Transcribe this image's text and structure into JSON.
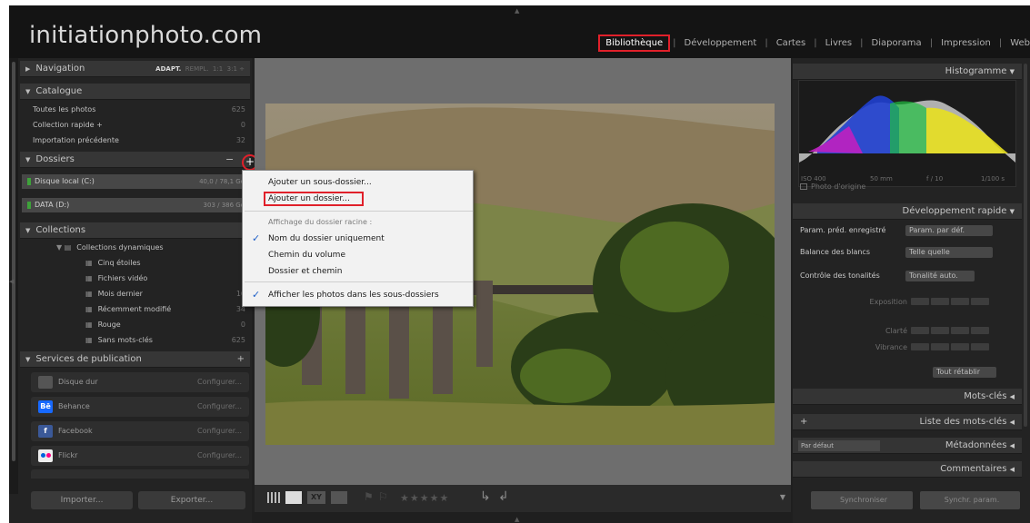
{
  "brand": "initiationphoto.com",
  "modules": [
    "Bibliothèque",
    "Développement",
    "Cartes",
    "Livres",
    "Diaporama",
    "Impression",
    "Web"
  ],
  "active_module": "Bibliothèque",
  "left": {
    "navigation": {
      "title": "Navigation",
      "modes": [
        "ADAPT.",
        "REMPL.",
        "1:1",
        "3:1 ÷"
      ]
    },
    "catalogue": {
      "title": "Catalogue",
      "items": [
        {
          "label": "Toutes les photos",
          "count": "625"
        },
        {
          "label": "Collection rapide +",
          "count": "0"
        },
        {
          "label": "Importation précédente",
          "count": "32"
        }
      ]
    },
    "dossiers": {
      "title": "Dossiers",
      "minus": "−",
      "plus": "+",
      "volumes": [
        {
          "label": "Disque local (C:)",
          "size": "40,0 / 78,1 Go"
        },
        {
          "label": "DATA (D:)",
          "size": "303 / 386 Go"
        }
      ]
    },
    "collections": {
      "title": "Collections",
      "group": "Collections dynamiques",
      "items": [
        {
          "label": "Cinq étoiles",
          "count": ""
        },
        {
          "label": "Fichiers vidéo",
          "count": ""
        },
        {
          "label": "Mois dernier",
          "count": "16"
        },
        {
          "label": "Récemment modifié",
          "count": "34"
        },
        {
          "label": "Rouge",
          "count": "0"
        },
        {
          "label": "Sans mots-clés",
          "count": "625"
        }
      ]
    },
    "services": {
      "title": "Services de publication",
      "plus": "+",
      "items": [
        {
          "label": "Disque dur",
          "action": "Configurer..."
        },
        {
          "label": "Behance",
          "action": "Configurer..."
        },
        {
          "label": "Facebook",
          "action": "Configurer..."
        },
        {
          "label": "Flickr",
          "action": "Configurer..."
        }
      ]
    },
    "import_button": "Importer...",
    "export_button": "Exporter..."
  },
  "context_menu": {
    "items": [
      {
        "label": "Ajouter un sous-dossier..."
      },
      {
        "label": "Ajouter un dossier..."
      },
      {
        "label": "Affichage du dossier racine :"
      },
      {
        "label": "Nom du dossier uniquement",
        "checked": true
      },
      {
        "label": "Chemin du volume",
        "checked": false
      },
      {
        "label": "Dossier et chemin",
        "checked": false
      },
      {
        "label": "Afficher les photos dans les sous-dossiers",
        "checked": true
      }
    ]
  },
  "toolbar": {
    "rating_stars": "★★★★★",
    "view_modes": [
      "grid",
      "loupe",
      "compare",
      "survey"
    ]
  },
  "right": {
    "histogram": {
      "title": "Histogramme",
      "iso": "ISO 400",
      "focal": "50 mm",
      "aperture": "f / 10",
      "shutter": "1/100 s",
      "original_photo": "Photo d'origine"
    },
    "quick_develop": {
      "title": "Développement rapide",
      "preset_label": "Param. préd. enregistré",
      "preset_value": "Param. par déf.",
      "wb_label": "Balance des blancs",
      "wb_value": "Telle quelle",
      "tone_label": "Contrôle des tonalités",
      "tone_button": "Tonalité auto.",
      "exposure": "Exposition",
      "clarity": "Clarté",
      "vibrance": "Vibrance",
      "reset": "Tout rétablir"
    },
    "keywords": "Mots-clés",
    "keyword_list": "Liste des mots-clés",
    "keyword_list_plus": "+",
    "metadata": "Métadonnées",
    "metadata_preset": "Par défaut",
    "comments": "Commentaires",
    "sync_button": "Synchroniser",
    "sync_settings_button": "Synchr. param."
  },
  "colors": {
    "highlight_red": "#e0202a",
    "check_blue": "#2060c8"
  }
}
